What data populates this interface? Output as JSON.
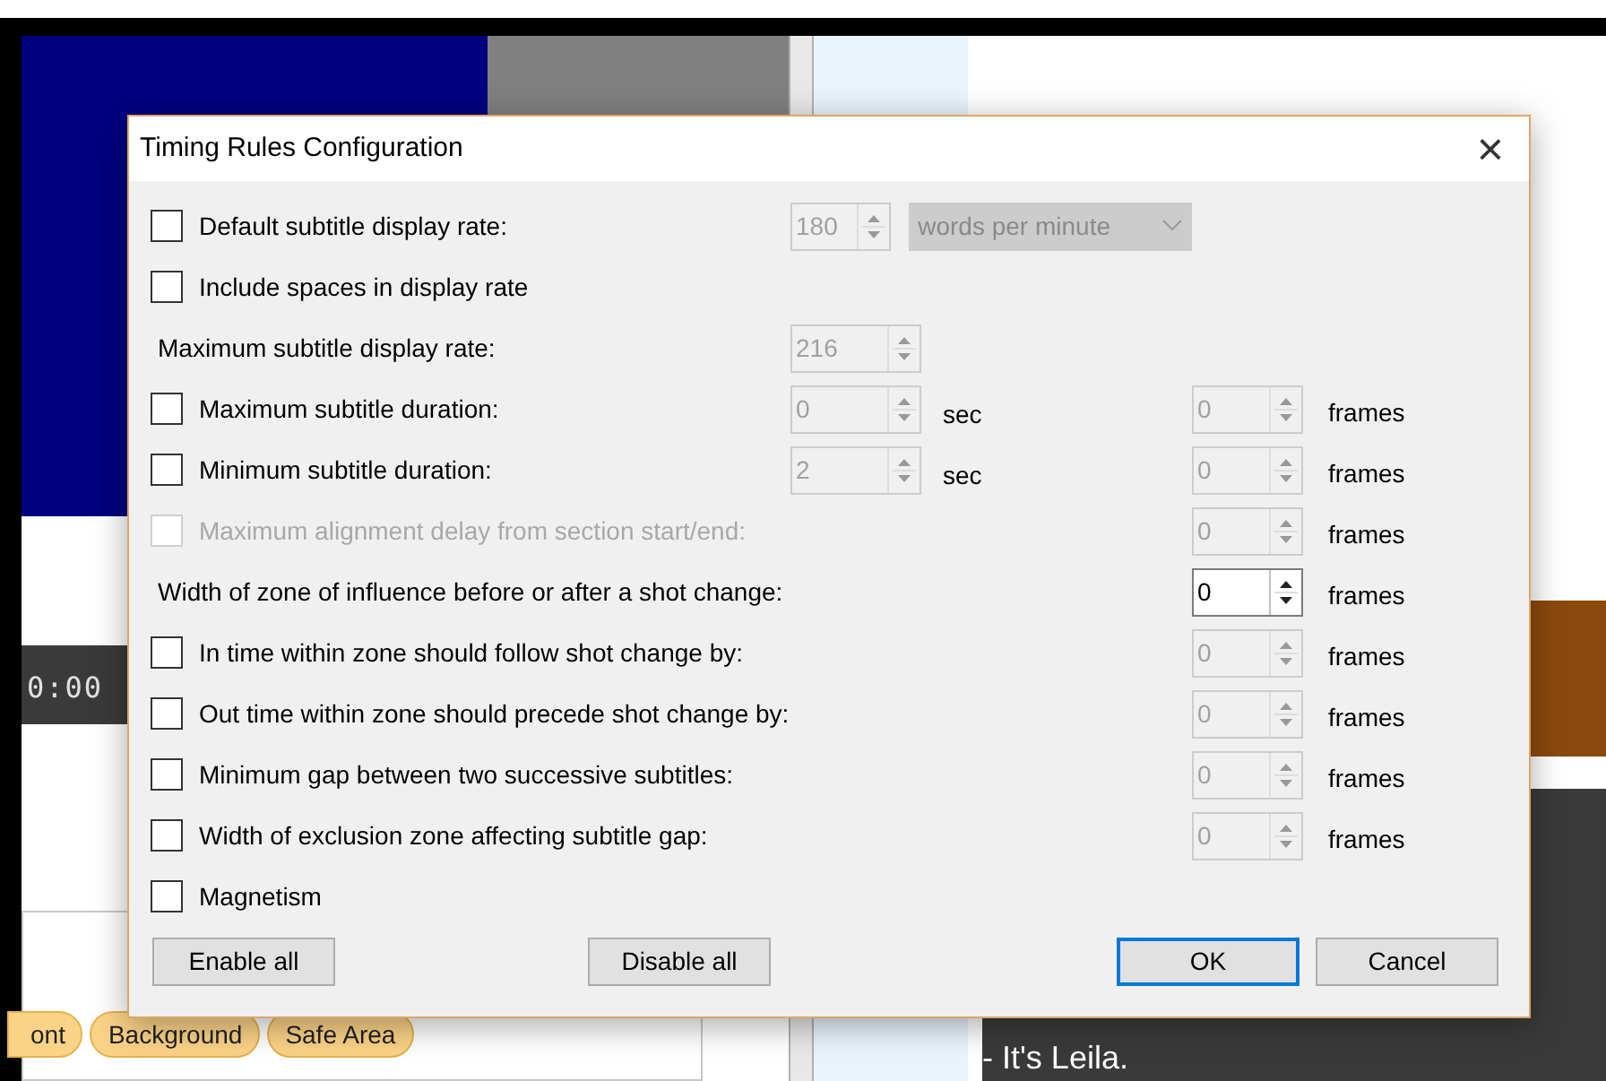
{
  "background": {
    "timecode": "0:00",
    "tabs": [
      "ont",
      "Background",
      "Safe Area"
    ],
    "subtitle_lines": [
      "- It's Leila."
    ]
  },
  "dialog": {
    "title": "Timing Rules Configuration",
    "close": "×",
    "rows": [
      {
        "kind": "checkbox",
        "label": "Default subtitle display rate:",
        "checked": false,
        "disabled": false,
        "field": {
          "value": "180",
          "enabled": false
        },
        "dropdown": {
          "value": "words per minute",
          "enabled": false
        }
      },
      {
        "kind": "checkbox",
        "label": "Include spaces in display rate",
        "checked": false,
        "disabled": false
      },
      {
        "kind": "label",
        "label": "Maximum subtitle display rate:",
        "field": {
          "value": "216",
          "enabled": false
        }
      },
      {
        "kind": "checkbox",
        "label": "Maximum subtitle duration:",
        "checked": false,
        "disabled": false,
        "field": {
          "value": "0",
          "enabled": false
        },
        "unit": "sec",
        "frames": {
          "value": "0",
          "enabled": false
        },
        "frames_unit": "frames"
      },
      {
        "kind": "checkbox",
        "label": "Minimum subtitle duration:",
        "checked": false,
        "disabled": false,
        "field": {
          "value": "2",
          "enabled": false
        },
        "unit": "sec",
        "frames": {
          "value": "0",
          "enabled": false
        },
        "frames_unit": "frames"
      },
      {
        "kind": "checkbox",
        "label": "Maximum alignment delay from section start/end:",
        "checked": false,
        "disabled": true,
        "frames": {
          "value": "0",
          "enabled": false
        },
        "frames_unit": "frames"
      },
      {
        "kind": "label",
        "label": "Width of zone of influence before or after a shot change:",
        "frames": {
          "value": "0",
          "enabled": true
        },
        "frames_unit": "frames"
      },
      {
        "kind": "checkbox",
        "label": "In time within zone should follow shot change by:",
        "checked": false,
        "disabled": false,
        "frames": {
          "value": "0",
          "enabled": false
        },
        "frames_unit": "frames"
      },
      {
        "kind": "checkbox",
        "label": "Out time within zone should precede shot change by:",
        "checked": false,
        "disabled": false,
        "frames": {
          "value": "0",
          "enabled": false
        },
        "frames_unit": "frames"
      },
      {
        "kind": "checkbox",
        "label": "Minimum gap between two successive subtitles:",
        "checked": false,
        "disabled": false,
        "frames": {
          "value": "0",
          "enabled": false
        },
        "frames_unit": "frames"
      },
      {
        "kind": "checkbox",
        "label": "Width of exclusion zone affecting subtitle gap:",
        "checked": false,
        "disabled": false,
        "frames": {
          "value": "0",
          "enabled": false
        },
        "frames_unit": "frames"
      },
      {
        "kind": "checkbox",
        "label": "Magnetism",
        "checked": false,
        "disabled": false
      }
    ],
    "buttons": [
      {
        "label": "Enable all",
        "default": false
      },
      {
        "label": "Disable all",
        "default": false
      },
      {
        "label": "OK",
        "default": true
      },
      {
        "label": "Cancel",
        "default": false
      }
    ]
  }
}
